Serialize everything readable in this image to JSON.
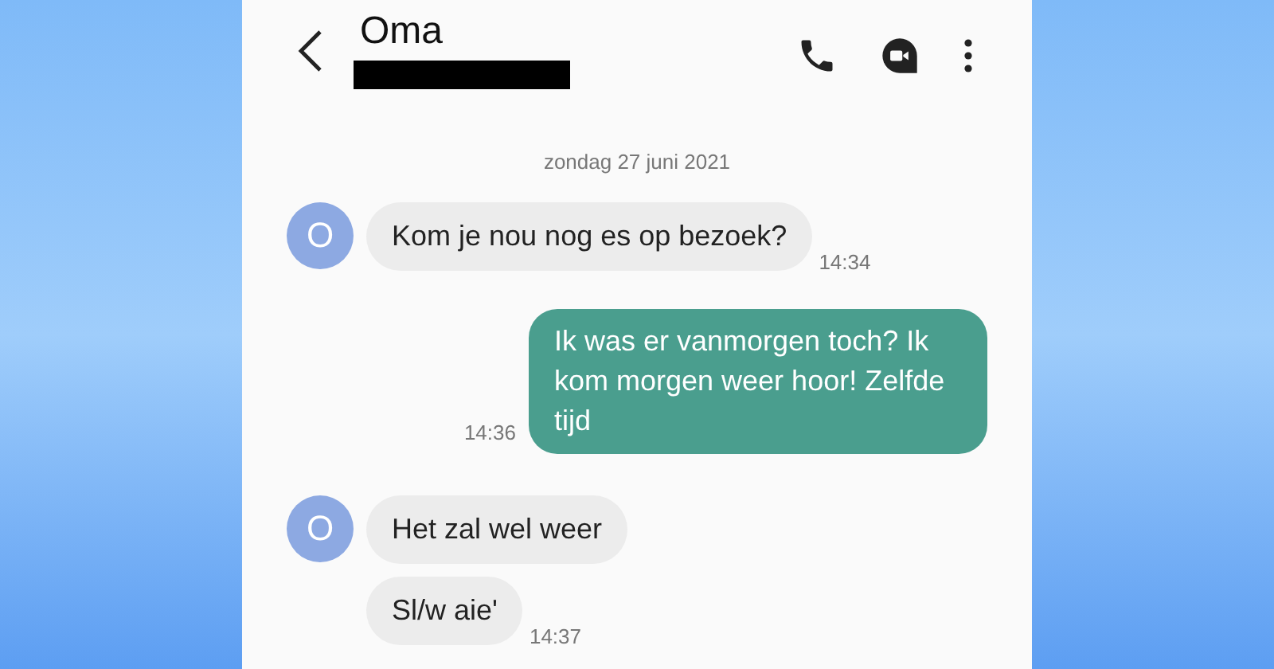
{
  "header": {
    "contact": "Oma",
    "redacted": true
  },
  "date": "zondag 27 juni 2021",
  "messages": [
    {
      "kind": "incoming",
      "avatar": "O",
      "text": "Kom je nou nog es op bezoek?",
      "time": "14:34"
    },
    {
      "kind": "outgoing",
      "text": "Ik was er vanmorgen toch? Ik kom morgen weer hoor! Zelfde tijd",
      "time": "14:36"
    },
    {
      "kind": "incoming",
      "avatar": "O",
      "text": "Het zal wel weer"
    },
    {
      "kind": "incoming",
      "text": "Sl/w aie'",
      "time": "14:37"
    }
  ]
}
